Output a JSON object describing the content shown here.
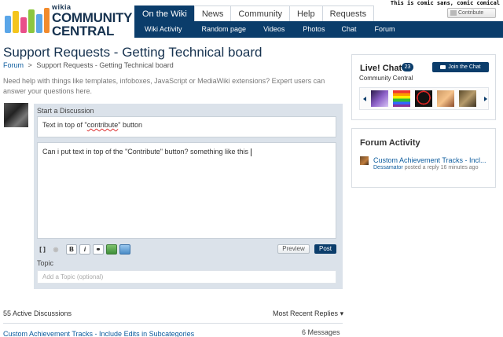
{
  "logo": {
    "small": "wikia",
    "line1": "COMMUNITY",
    "line2": "CENTRAL"
  },
  "top_nav": [
    "On the Wiki",
    "News",
    "Community",
    "Help",
    "Requests"
  ],
  "sub_nav": [
    "Wiki Activity",
    "Random page",
    "Videos",
    "Photos",
    "Chat",
    "Forum"
  ],
  "user_tagline": "This is comic sans, comic comical",
  "contribute_label": "Contribute",
  "page": {
    "title": "Support Requests - Getting Technical board",
    "breadcrumb_root": "Forum",
    "breadcrumb_sep": ">",
    "breadcrumb_current": "Support Requests - Getting Technical board",
    "intro": "Need help with things like templates, infoboxes, JavaScript or MediaWiki extensions? Expert users can answer your questions here."
  },
  "composer": {
    "label": "Start a Discussion",
    "subject_before": "Text in top of \"",
    "subject_misspelled": "contribute",
    "subject_after": "\" button",
    "body": "Can i put text in top of the \"Contribute\" button? something like this",
    "toolbar": {
      "source": "[ ]",
      "bold": "B",
      "italic": "i"
    },
    "preview_label": "Preview",
    "post_label": "Post",
    "topic_label": "Topic",
    "topic_placeholder": "Add a Topic (optional)"
  },
  "discussions": {
    "active_count": "55 Active Discussions",
    "sort_label": "Most Recent Replies",
    "sort_arrow": "▾",
    "first_thread_title": "Custom Achievement Tracks - Include Edits in Subcategories",
    "first_thread_count": "6 Messages"
  },
  "live_chat": {
    "title": "Live! Chat",
    "count": "23",
    "join_label": "Join the Chat",
    "community": "Community Central"
  },
  "forum_activity": {
    "title": "Forum Activity",
    "item_title": "Custom Achievement Tracks - Incl...",
    "item_user": "Dessamator",
    "item_meta": "posted a reply 16 minutes ago"
  },
  "colors": {
    "brand_navy": "#0b3d6b",
    "link_blue": "#0b5b9d",
    "composer_bg": "#dbe2ea"
  }
}
